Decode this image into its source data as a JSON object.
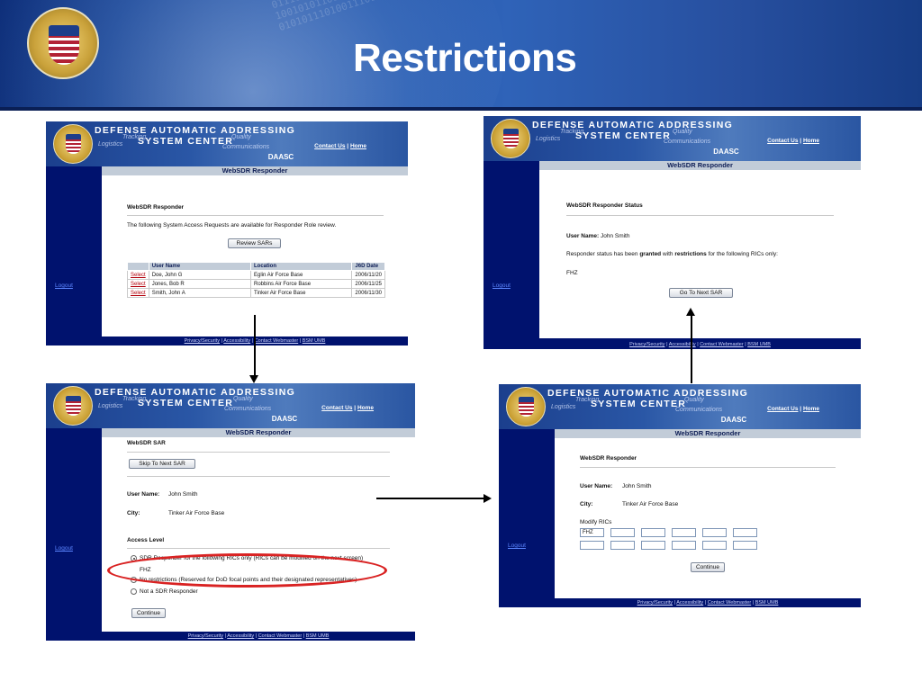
{
  "slide": {
    "title": "Restrictions",
    "colors": {
      "banner": "#1d4a9e",
      "app_navy": "#00126e",
      "highlight": "#d92222"
    }
  },
  "header": {
    "org_line1": "DEFENSE AUTOMATIC ADDRESSING",
    "org_line2": "SYSTEM CENTER",
    "tagline_tracking": "Tracking",
    "tagline_logistics": "Logistics",
    "tagline_quality": "Quality",
    "tagline_communications": "Communications",
    "contact_link": "Contact Us",
    "separator": "|",
    "home_link": "Home",
    "site_name": "DAASC",
    "app_title": "WebSDR Responder",
    "logout": "Logout"
  },
  "footer": {
    "privacy": "Privacy/Security",
    "accessibility": "Accessibility",
    "webmaster": "Contact Webmaster",
    "bsm": "BSM UMB"
  },
  "screen_review": {
    "heading": "WebSDR Responder",
    "intro": "The following System Access Requests are available for Responder Role review.",
    "review_button": "Review SARs",
    "columns": [
      "",
      "User Name",
      "Location",
      "J6D Date"
    ],
    "rows": [
      {
        "action": "Select",
        "user": "Doe, John G",
        "location": "Eglin Air Force Base",
        "date": "2006/11/20"
      },
      {
        "action": "Select",
        "user": "Jones, Bob R",
        "location": "Robbins Air Force Base",
        "date": "2006/11/25"
      },
      {
        "action": "Select",
        "user": "Smith, John A",
        "location": "Tinker Air Force Base",
        "date": "2006/11/30"
      }
    ]
  },
  "screen_status": {
    "heading": "WebSDR Responder Status",
    "user_label": "User Name:",
    "user_value": "John Smith",
    "msg_part1": "Responder status has been",
    "msg_granted": "granted",
    "msg_part2": "with",
    "msg_restrictions": "restrictions",
    "msg_part3": "for the following RICs only:",
    "ric": "FHZ",
    "next_button": "Go To Next SAR"
  },
  "screen_sar": {
    "heading": "WebSDR SAR",
    "skip_button": "Skip To Next SAR",
    "user_label": "User Name:",
    "user_value": "John Smith",
    "city_label": "City:",
    "city_value": "Tinker Air Force Base",
    "access_heading": "Access Level",
    "options": [
      {
        "label": "SDR Responder for the following RICs only (RICs can be modified on the next screen)",
        "selected": true
      },
      {
        "label": "No restrictions (Reserved for DoD focal points and their designated representatives)",
        "selected": false
      },
      {
        "label": "Not a SDR Responder",
        "selected": false
      }
    ],
    "option_ric": "FHZ",
    "continue_button": "Continue"
  },
  "screen_modify": {
    "heading": "WebSDR Responder",
    "user_label": "User Name:",
    "user_value": "John Smith",
    "city_label": "City:",
    "city_value": "Tinker Air Force Base",
    "ric_label": "Modify RICs",
    "ric_fields": [
      "FHZ",
      "",
      "",
      "",
      "",
      "",
      "",
      "",
      "",
      "",
      "",
      ""
    ],
    "continue_button": "Continue"
  }
}
